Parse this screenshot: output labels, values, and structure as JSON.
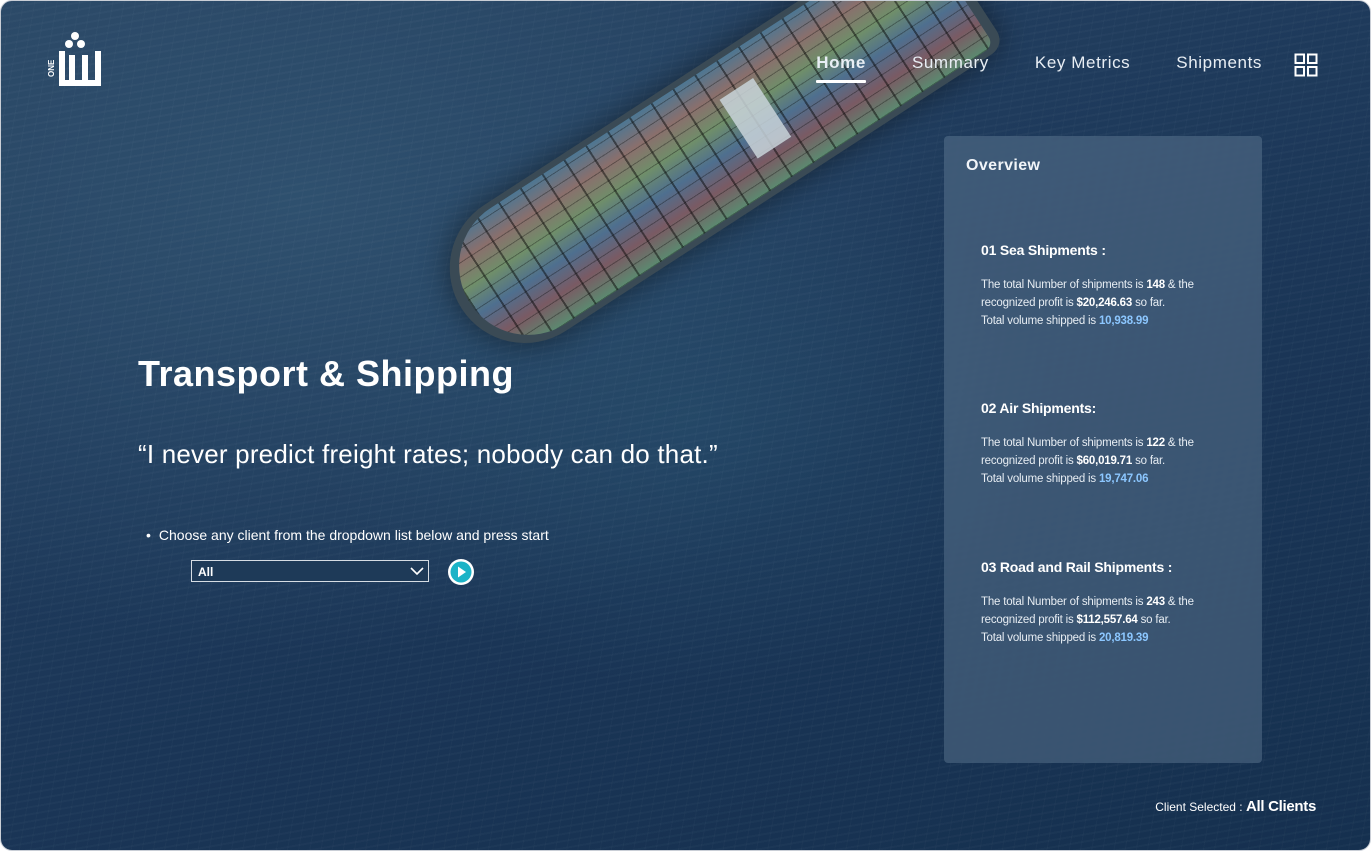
{
  "logo": {
    "text": "ONE"
  },
  "nav": {
    "items": [
      {
        "label": "Home",
        "active": true
      },
      {
        "label": "Summary",
        "active": false
      },
      {
        "label": "Key Metrics",
        "active": false
      },
      {
        "label": "Shipments",
        "active": false
      }
    ],
    "grid_icon": "grid-icon"
  },
  "hero": {
    "title": "Transport & Shipping",
    "quote": "“I never predict freight rates; nobody can do that.”",
    "hint_bullet": "•",
    "hint": "Choose any client from the dropdown list below and press start"
  },
  "client_dropdown": {
    "value": "All"
  },
  "overview": {
    "title": "Overview",
    "sections": [
      {
        "heading": "01  Sea Shipments :",
        "line1_prefix": "The total Number of shipments is ",
        "count": "148",
        "line1_suffix": " & the",
        "line2_prefix": "recognized profit  is ",
        "profit": "$20,246.63",
        "line2_suffix": " so far.",
        "line3_prefix": "Total volume shipped is ",
        "volume": "10,938.99"
      },
      {
        "heading": "02  Air Shipments:",
        "line1_prefix": "The total Number of shipments is  ",
        "count": "122",
        "line1_suffix": " & the",
        "line2_prefix": "recognized profit  is ",
        "profit": "$60,019.71",
        "line2_suffix": " so far.",
        "line3_prefix": "Total volume shipped is ",
        "volume": "19,747.06"
      },
      {
        "heading": "03  Road and Rail Shipments :",
        "line1_prefix": "The total Number of shipments is  ",
        "count": "243",
        "line1_suffix": " & the",
        "line2_prefix": "recognized profit  is ",
        "profit": "$112,557.64",
        "line2_suffix": " so far.",
        "line3_prefix": "Total volume shipped is ",
        "volume": "20,819.39"
      }
    ]
  },
  "footer": {
    "label": "Client Selected : ",
    "client": "All Clients"
  },
  "colors": {
    "accent_volume": "#8cc7ff",
    "start_button": "#1bb3c7"
  }
}
